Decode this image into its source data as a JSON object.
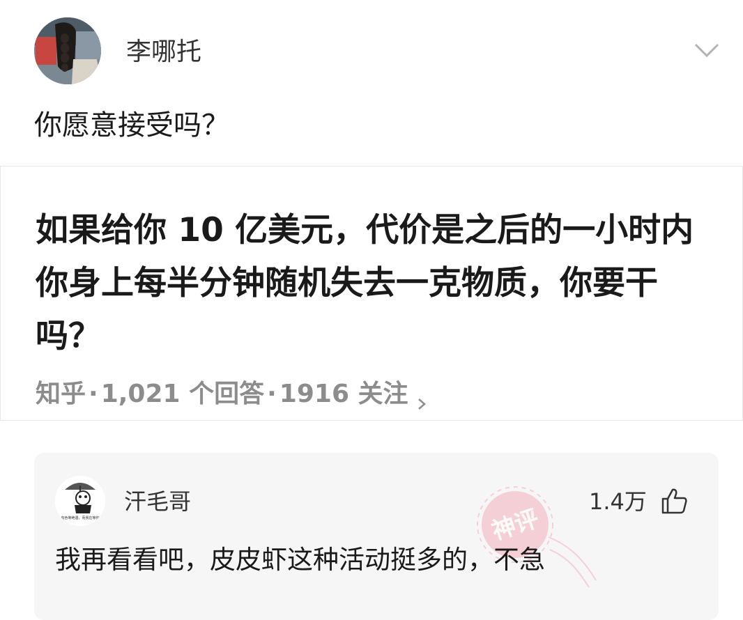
{
  "post": {
    "author": "李哪托",
    "text": "你愿意接受吗？",
    "menu_icon": "chevron-down-icon"
  },
  "card": {
    "title": "如果给你 10 亿美元，代价是之后的一小时内你身上每半分钟随机失去一克物质，你要干吗？",
    "source": "知乎",
    "sep": "·",
    "answers": "1,021 个回答",
    "followers": "1916 关注",
    "arrow_icon": "chevron-right-icon"
  },
  "comment": {
    "author": "汗毛哥",
    "likes": "1.4万",
    "like_icon": "thumbs-up-icon",
    "text": "我再看看吧，皮皮虾这种活动挺多的，不急",
    "avatar_caption": "有色等绝遇，而我在等你",
    "stamp_text": "神评",
    "stamp_color": "#f26d86"
  }
}
